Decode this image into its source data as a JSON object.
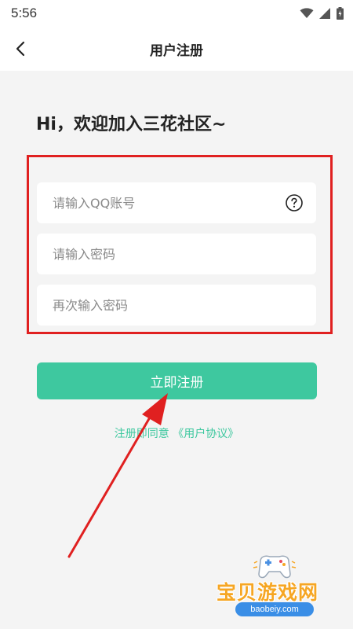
{
  "status_bar": {
    "time": "5:56",
    "icons": [
      "wifi-icon",
      "signal-icon",
      "battery-icon"
    ]
  },
  "nav": {
    "title": "用户注册",
    "back_icon": "chevron-left-icon"
  },
  "main": {
    "greeting": "Hi，欢迎加入三花社区~",
    "fields": {
      "qq": {
        "value": "",
        "placeholder": "请输入QQ账号",
        "icon": "question-circle-icon"
      },
      "password": {
        "value": "",
        "placeholder": "请输入密码"
      },
      "confirm_password": {
        "value": "",
        "placeholder": "再次输入密码"
      }
    },
    "register_button": "立即注册",
    "agreement": {
      "prefix": "注册即同意",
      "link": "《用户协议》"
    }
  },
  "annotations": {
    "highlight_color": "#e02020",
    "arrow_color": "#e02020"
  },
  "watermark": {
    "title": "宝贝游戏网",
    "url": "baobeiy.com",
    "icon": "gamepad-icon"
  },
  "colors": {
    "accent": "#3ec89f",
    "background": "#f4f4f4",
    "card": "#ffffff"
  }
}
